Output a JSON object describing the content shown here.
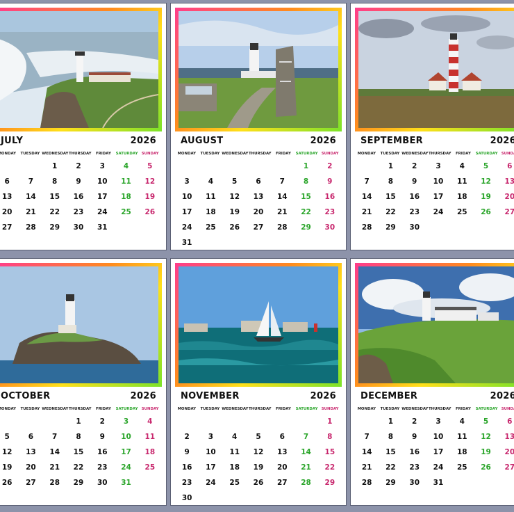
{
  "weekdays": [
    "MONDAY",
    "TUESDAY",
    "WEDNESDAY",
    "THURSDAY",
    "FRIDAY",
    "SATURDAY",
    "SUNDAY"
  ],
  "colors": {
    "accent_saturday": "#2aa52a",
    "accent_sunday": "#c8286e",
    "background": "#8d93aa"
  },
  "months": [
    {
      "name": "JULY",
      "year": "2026",
      "photo": "cliff-lighthouse-waves",
      "weeks": [
        [
          {
            "d": ""
          },
          {
            "d": ""
          },
          {
            "d": "1"
          },
          {
            "d": "2"
          },
          {
            "d": "3"
          },
          {
            "d": "4"
          },
          {
            "d": "5"
          }
        ],
        [
          {
            "d": "6"
          },
          {
            "d": "7"
          },
          {
            "d": "8"
          },
          {
            "d": "9"
          },
          {
            "d": "10"
          },
          {
            "d": "11"
          },
          {
            "d": "12"
          }
        ],
        [
          {
            "d": "13"
          },
          {
            "d": "14"
          },
          {
            "d": "15"
          },
          {
            "d": "16"
          },
          {
            "d": "17"
          },
          {
            "d": "18"
          },
          {
            "d": "19"
          }
        ],
        [
          {
            "d": "20"
          },
          {
            "d": "21"
          },
          {
            "d": "22"
          },
          {
            "d": "23"
          },
          {
            "d": "24"
          },
          {
            "d": "25"
          },
          {
            "d": "26"
          }
        ],
        [
          {
            "d": "27"
          },
          {
            "d": "28"
          },
          {
            "d": "29"
          },
          {
            "d": "30"
          },
          {
            "d": "31"
          },
          {
            "d": ""
          },
          {
            "d": ""
          }
        ]
      ]
    },
    {
      "name": "AUGUST",
      "year": "2026",
      "photo": "lighthouse-with-welcome-stone",
      "weeks": [
        [
          {
            "d": ""
          },
          {
            "d": ""
          },
          {
            "d": ""
          },
          {
            "d": ""
          },
          {
            "d": ""
          },
          {
            "d": "1"
          },
          {
            "d": "2"
          }
        ],
        [
          {
            "d": "3"
          },
          {
            "d": "4"
          },
          {
            "d": "5"
          },
          {
            "d": "6"
          },
          {
            "d": "7"
          },
          {
            "d": "8"
          },
          {
            "d": "9"
          }
        ],
        [
          {
            "d": "10"
          },
          {
            "d": "11"
          },
          {
            "d": "12"
          },
          {
            "d": "13"
          },
          {
            "d": "14"
          },
          {
            "d": "15"
          },
          {
            "d": "16"
          }
        ],
        [
          {
            "d": "17"
          },
          {
            "d": "18"
          },
          {
            "d": "19"
          },
          {
            "d": "20"
          },
          {
            "d": "21"
          },
          {
            "d": "22"
          },
          {
            "d": "23"
          }
        ],
        [
          {
            "d": "24"
          },
          {
            "d": "25"
          },
          {
            "d": "26"
          },
          {
            "d": "27"
          },
          {
            "d": "28"
          },
          {
            "d": "29"
          },
          {
            "d": "30"
          }
        ],
        [
          {
            "d": "31"
          },
          {
            "d": ""
          },
          {
            "d": ""
          },
          {
            "d": ""
          },
          {
            "d": ""
          },
          {
            "d": ""
          },
          {
            "d": ""
          }
        ]
      ]
    },
    {
      "name": "SEPTEMBER",
      "year": "2026",
      "photo": "striped-lighthouse",
      "weeks": [
        [
          {
            "d": ""
          },
          {
            "d": "1"
          },
          {
            "d": "2"
          },
          {
            "d": "3"
          },
          {
            "d": "4"
          },
          {
            "d": "5"
          },
          {
            "d": "6"
          }
        ],
        [
          {
            "d": "7"
          },
          {
            "d": "8"
          },
          {
            "d": "9"
          },
          {
            "d": "10"
          },
          {
            "d": "11"
          },
          {
            "d": "12"
          },
          {
            "d": "13"
          }
        ],
        [
          {
            "d": "14"
          },
          {
            "d": "15"
          },
          {
            "d": "16"
          },
          {
            "d": "17"
          },
          {
            "d": "18"
          },
          {
            "d": "19"
          },
          {
            "d": "20"
          }
        ],
        [
          {
            "d": "21"
          },
          {
            "d": "22"
          },
          {
            "d": "23"
          },
          {
            "d": "24"
          },
          {
            "d": "25"
          },
          {
            "d": "26"
          },
          {
            "d": "27"
          }
        ],
        [
          {
            "d": "28"
          },
          {
            "d": "29"
          },
          {
            "d": "30"
          },
          {
            "d": ""
          },
          {
            "d": ""
          },
          {
            "d": ""
          },
          {
            "d": ""
          }
        ]
      ]
    },
    {
      "name": "OCTOBER",
      "year": "2026",
      "photo": "island-lighthouse",
      "weeks": [
        [
          {
            "d": ""
          },
          {
            "d": ""
          },
          {
            "d": ""
          },
          {
            "d": "1"
          },
          {
            "d": "2"
          },
          {
            "d": "3"
          },
          {
            "d": "4"
          }
        ],
        [
          {
            "d": "5"
          },
          {
            "d": "6"
          },
          {
            "d": "7"
          },
          {
            "d": "8"
          },
          {
            "d": "9"
          },
          {
            "d": "10"
          },
          {
            "d": "11"
          }
        ],
        [
          {
            "d": "12"
          },
          {
            "d": "13"
          },
          {
            "d": "14"
          },
          {
            "d": "15"
          },
          {
            "d": "16"
          },
          {
            "d": "17"
          },
          {
            "d": "18"
          }
        ],
        [
          {
            "d": "19"
          },
          {
            "d": "20"
          },
          {
            "d": "21"
          },
          {
            "d": "22"
          },
          {
            "d": "23"
          },
          {
            "d": "24"
          },
          {
            "d": "25"
          }
        ],
        [
          {
            "d": "26"
          },
          {
            "d": "27"
          },
          {
            "d": "28"
          },
          {
            "d": "29"
          },
          {
            "d": "30"
          },
          {
            "d": "31"
          },
          {
            "d": ""
          }
        ]
      ]
    },
    {
      "name": "NOVEMBER",
      "year": "2026",
      "photo": "sailboat-rocks",
      "weeks": [
        [
          {
            "d": ""
          },
          {
            "d": ""
          },
          {
            "d": ""
          },
          {
            "d": ""
          },
          {
            "d": ""
          },
          {
            "d": ""
          },
          {
            "d": "1"
          }
        ],
        [
          {
            "d": "2"
          },
          {
            "d": "3"
          },
          {
            "d": "4"
          },
          {
            "d": "5"
          },
          {
            "d": "6"
          },
          {
            "d": "7"
          },
          {
            "d": "8"
          }
        ],
        [
          {
            "d": "9"
          },
          {
            "d": "10"
          },
          {
            "d": "11"
          },
          {
            "d": "12"
          },
          {
            "d": "13"
          },
          {
            "d": "14"
          },
          {
            "d": "15"
          }
        ],
        [
          {
            "d": "16"
          },
          {
            "d": "17"
          },
          {
            "d": "18"
          },
          {
            "d": "19"
          },
          {
            "d": "20"
          },
          {
            "d": "21"
          },
          {
            "d": "22"
          }
        ],
        [
          {
            "d": "23"
          },
          {
            "d": "24"
          },
          {
            "d": "25"
          },
          {
            "d": "26"
          },
          {
            "d": "27"
          },
          {
            "d": "28"
          },
          {
            "d": "29"
          }
        ],
        [
          {
            "d": "30"
          },
          {
            "d": ""
          },
          {
            "d": ""
          },
          {
            "d": ""
          },
          {
            "d": ""
          },
          {
            "d": ""
          },
          {
            "d": ""
          }
        ]
      ]
    },
    {
      "name": "DECEMBER",
      "year": "2026",
      "photo": "headland-lighthouse",
      "weeks": [
        [
          {
            "d": ""
          },
          {
            "d": "1"
          },
          {
            "d": "2"
          },
          {
            "d": "3"
          },
          {
            "d": "4"
          },
          {
            "d": "5"
          },
          {
            "d": "6"
          }
        ],
        [
          {
            "d": "7"
          },
          {
            "d": "8"
          },
          {
            "d": "9"
          },
          {
            "d": "10"
          },
          {
            "d": "11"
          },
          {
            "d": "12"
          },
          {
            "d": "13"
          }
        ],
        [
          {
            "d": "14"
          },
          {
            "d": "15"
          },
          {
            "d": "16"
          },
          {
            "d": "17"
          },
          {
            "d": "18"
          },
          {
            "d": "19"
          },
          {
            "d": "20"
          }
        ],
        [
          {
            "d": "21"
          },
          {
            "d": "22"
          },
          {
            "d": "23"
          },
          {
            "d": "24"
          },
          {
            "d": "25"
          },
          {
            "d": "26"
          },
          {
            "d": "27"
          }
        ],
        [
          {
            "d": "28"
          },
          {
            "d": "29"
          },
          {
            "d": "30"
          },
          {
            "d": "31"
          },
          {
            "d": ""
          },
          {
            "d": ""
          },
          {
            "d": ""
          }
        ]
      ]
    }
  ]
}
